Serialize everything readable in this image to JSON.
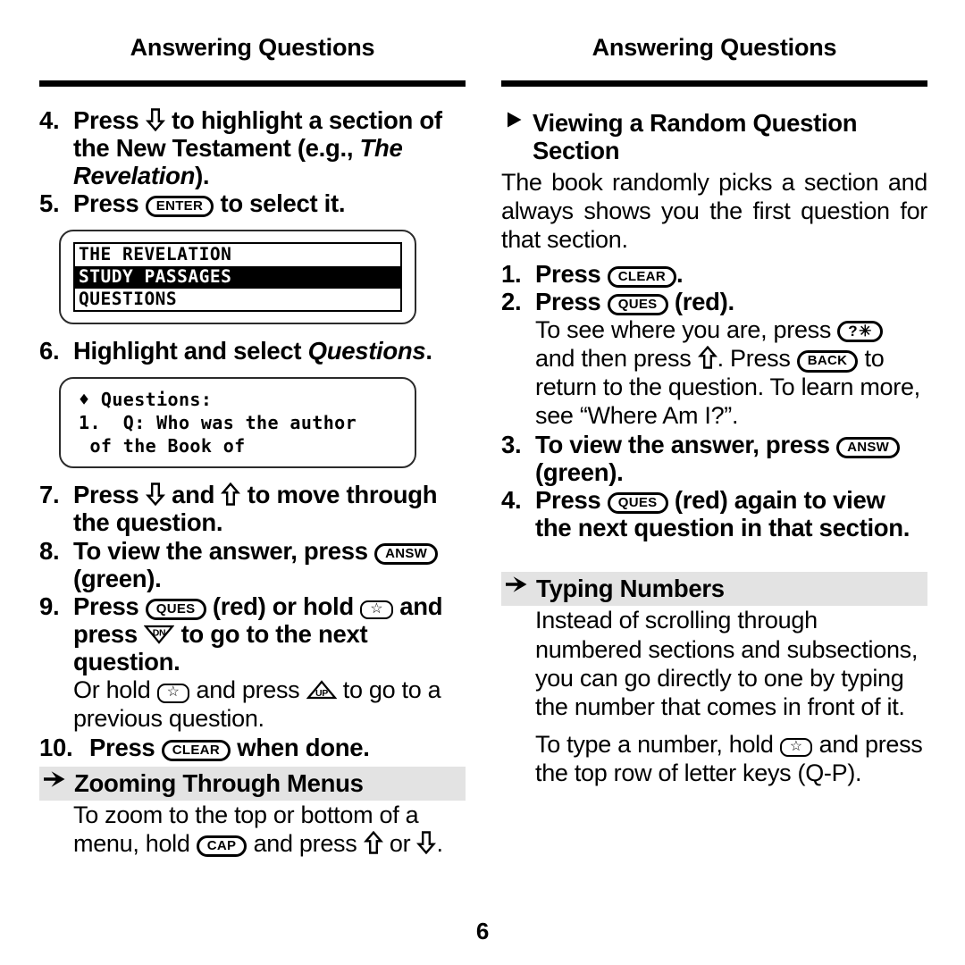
{
  "page": {
    "number": "6",
    "running_head_left": "Answering Questions",
    "running_head_right": "Answering Questions"
  },
  "left_column": {
    "step4": {
      "num": "4.",
      "text_a": "Press ",
      "glyph": "down-arrow",
      "text_b": " to highlight a section of the New Testament (e.g., ",
      "italic": "The Revelation",
      "text_c": ")."
    },
    "step5": {
      "num": "5.",
      "text_a": "Press ",
      "key": "ENTER",
      "text_b": " to select it."
    },
    "lcd1": {
      "line1": "THE REVELATION",
      "line2": "STUDY PASSAGES",
      "line3": "QUESTIONS",
      "highlighted_line": "STUDY PASSAGES"
    },
    "step6": {
      "num": "6.",
      "text_a": "Highlight and select ",
      "italic": "Questions",
      "text_b": "."
    },
    "lcd2": {
      "line1": "♦ Questions:",
      "line2": "1.  Q: Who was the author",
      "line3": " of the Book of"
    },
    "step7": {
      "num": "7.",
      "text_a": "Press ",
      "glyph_a": "down-arrow",
      "text_b": " and ",
      "glyph_b": "up-arrow",
      "text_c": " to move through the question."
    },
    "step8": {
      "num": "8.",
      "text_a": "To view the answer, press ",
      "key": "ANSW",
      "text_b": " (green)."
    },
    "step9": {
      "num": "9.",
      "text_a": "Press ",
      "key_a": "QUES",
      "text_b": " (red) or hold ",
      "key_b": "☆",
      "text_c": " and press ",
      "glyph": "dn-triangle",
      "text_d": " to go to the next question."
    },
    "step9_note": {
      "text_a": "Or hold ",
      "key": "☆",
      "text_b": " and press ",
      "glyph": "up-triangle",
      "text_c": " to go to a previous question."
    },
    "step10": {
      "num": "10.",
      "text_a": "Press ",
      "key": "CLEAR",
      "text_b": " when done."
    },
    "section_zooming": {
      "arrow": "arrowhead-icon",
      "title": "Zooming Through Menus",
      "body_a": "To zoom to the top or bottom of a menu, hold ",
      "key": "CAP",
      "body_b": " and press ",
      "glyph_a": "up-arrow",
      "body_c": " or ",
      "glyph_b": "down-arrow",
      "body_d": "."
    }
  },
  "right_column": {
    "section_random": {
      "arrow": "solid-triangle-icon",
      "title": "Viewing a Random Question Section",
      "body": "The book randomly picks a section and always shows you the first question for that section."
    },
    "step1": {
      "num": "1.",
      "text_a": "Press ",
      "key": "CLEAR",
      "text_b": "."
    },
    "step2": {
      "num": "2.",
      "text_a": "Press ",
      "key": "QUES",
      "text_b": " (red)."
    },
    "step2_note": {
      "text_a": "To see where you are, press ",
      "key_a": "?✳",
      "text_b": " and then press ",
      "glyph": "up-arrow",
      "text_c": ". Press ",
      "key_b": "BACK",
      "text_d": " to return to the question. To learn more, see “Where Am I?”."
    },
    "step3": {
      "num": "3.",
      "text_a": "To view the answer, press ",
      "key": "ANSW",
      "text_b": " (green)."
    },
    "step4": {
      "num": "4.",
      "text_a": "Press ",
      "key": "QUES",
      "text_b": " (red) again to view the next question in that section."
    },
    "section_typing": {
      "arrow": "arrowhead-icon",
      "title": "Typing Numbers",
      "body1": "Instead of scrolling through numbered sections and subsections, you can go directly to one by typing the number that comes in front of it.",
      "body2_a": "To type a number, hold ",
      "key": "☆",
      "body2_b": " and press the top row of letter keys (Q-P)."
    }
  },
  "colors": {
    "ink": "#000000",
    "paper": "#ffffff",
    "header_shade": "#e3e3e3"
  }
}
